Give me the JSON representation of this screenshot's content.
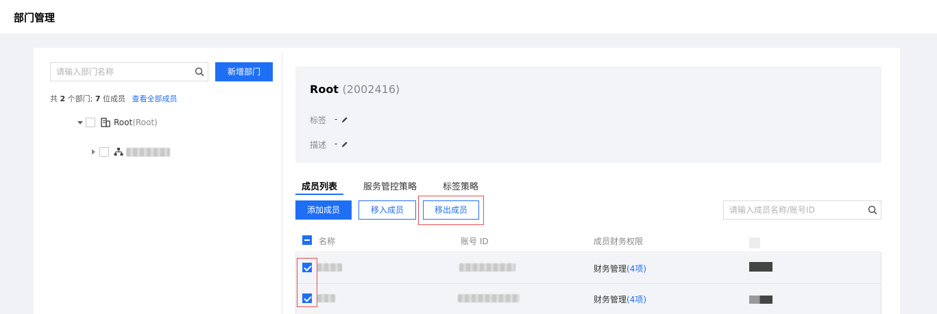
{
  "page": {
    "title": "部门管理"
  },
  "left": {
    "search_placeholder": "请输入部门名称",
    "add_dept_button": "新增部门",
    "summary": {
      "prefix": "共",
      "dept_count": "2",
      "dept_suffix": "个部门;",
      "member_count": "7",
      "member_suffix": "位成员",
      "view_all_link": "查看全部成员"
    },
    "tree": {
      "root_name": "Root",
      "root_sub": "(Root)"
    }
  },
  "info": {
    "name": "Root",
    "id": "(2002416)",
    "tag_label": "标签",
    "tag_value": "-",
    "desc_label": "描述",
    "desc_value": "-"
  },
  "tabs": [
    {
      "label": "成员列表",
      "active": true
    },
    {
      "label": "服务管控策略",
      "active": false
    },
    {
      "label": "标签策略",
      "active": false
    }
  ],
  "actions": {
    "add_member": "添加成员",
    "move_in": "移入成员",
    "move_out": "移出成员",
    "search_placeholder": "请输入成员名称/账号ID"
  },
  "table": {
    "headers": {
      "name": "名称",
      "account_id": "账号 ID",
      "finance": "成员财务权限"
    },
    "rows": [
      {
        "checked": true,
        "finance_label": "财务管理",
        "finance_count": "(4项)"
      },
      {
        "checked": true,
        "finance_label": "财务管理",
        "finance_count": "(4项)"
      }
    ]
  },
  "colors": {
    "primary": "#1f6ff5",
    "highlight": "#e34d4d",
    "panel_bg": "#f3f4f7"
  }
}
